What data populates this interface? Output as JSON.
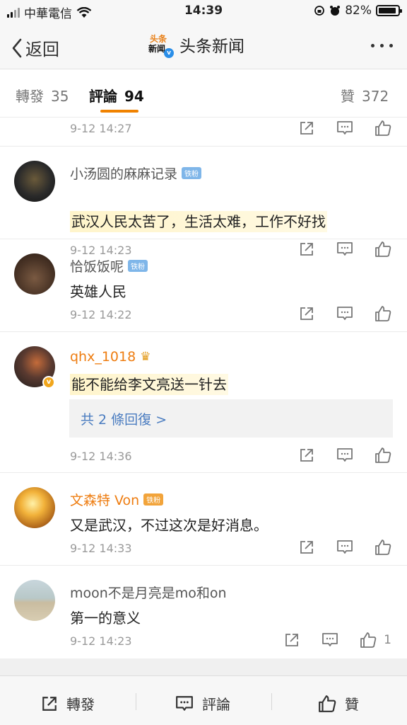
{
  "statusbar": {
    "carrier": "中華電信",
    "time": "14:39",
    "battery": "82%"
  },
  "navbar": {
    "back_label": "返回",
    "logo_line1": "头条",
    "logo_line2": "新闻",
    "title": "头条新闻"
  },
  "tabs": [
    {
      "label": "轉發",
      "count": "35"
    },
    {
      "label": "評論",
      "count": "94"
    },
    {
      "label": "贊",
      "count": "372"
    }
  ],
  "comments": [
    {
      "time": "9-12 14:27"
    },
    {
      "username": "小汤圆的麻麻记录",
      "badge": "铁粉",
      "text": "武汉人民太苦了，生活太难，工作不好找",
      "time": "9-12 14:23"
    },
    {
      "username": "恰饭饭呢",
      "badge": "铁粉",
      "text": "英雄人民",
      "time": "9-12 14:22"
    },
    {
      "username": "qhx_1018",
      "text": "能不能给李文亮送一针去",
      "replies": "共 2 條回復 >",
      "time": "9-12 14:36"
    },
    {
      "username": "文森特 Von",
      "badge": "铁粉",
      "text": "又是武汉，不过这次是好消息。",
      "time": "9-12 14:33"
    },
    {
      "username": "moon不是月亮是mo和on",
      "text": "第一的意义",
      "time": "9-12 14:23",
      "likes": "1"
    }
  ],
  "bottombar": {
    "repost": "轉發",
    "comment": "評論",
    "like": "贊"
  },
  "colors": {
    "accent": "#f08200",
    "link": "#4a7cc0",
    "vip_name": "#ee7d11"
  }
}
